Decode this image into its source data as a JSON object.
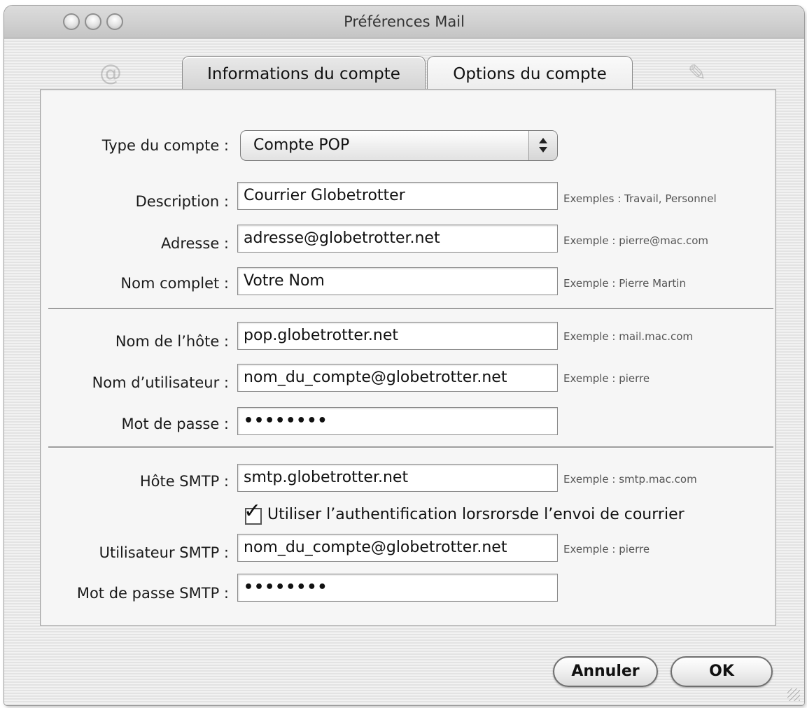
{
  "window": {
    "title": "Préférences Mail"
  },
  "tabs": [
    {
      "label": "Informations du compte",
      "active": true
    },
    {
      "label": "Options du compte",
      "active": false
    }
  ],
  "form": {
    "account_type_label": "Type du compte :",
    "account_type_value": "Compte POP",
    "description_label": "Description :",
    "description_value": "Courrier Globetrotter",
    "description_hint": "Exemples : Travail, Personnel",
    "address_label": "Adresse :",
    "address_value": "adresse@globetrotter.net",
    "address_hint": "Exemple : pierre@mac.com",
    "fullname_label": "Nom complet :",
    "fullname_value": "Votre Nom",
    "fullname_hint": "Exemple : Pierre Martin",
    "host_label": "Nom de l’hôte :",
    "host_value": "pop.globetrotter.net",
    "host_hint": "Exemple : mail.mac.com",
    "username_label": "Nom d’utilisateur :",
    "username_value": "nom_du_compte@globetrotter.net",
    "username_hint": "Exemple : pierre",
    "password_label": "Mot de passe :",
    "password_value": "••••••••",
    "smtp_host_label": "Hôte SMTP :",
    "smtp_host_value": "smtp.globetrotter.net",
    "smtp_host_hint": "Exemple : smtp.mac.com",
    "auth_checkbox_label": "Utiliser l’authentification  lorsrorsde l’envoi de courrier",
    "auth_checked": true,
    "smtp_user_label": "Utilisateur SMTP :",
    "smtp_user_value": "nom_du_compte@globetrotter.net",
    "smtp_user_hint": "Exemple : pierre",
    "smtp_password_label": "Mot de passe SMTP :",
    "smtp_password_value": "••••••••"
  },
  "buttons": {
    "cancel": "Annuler",
    "ok": "OK"
  }
}
